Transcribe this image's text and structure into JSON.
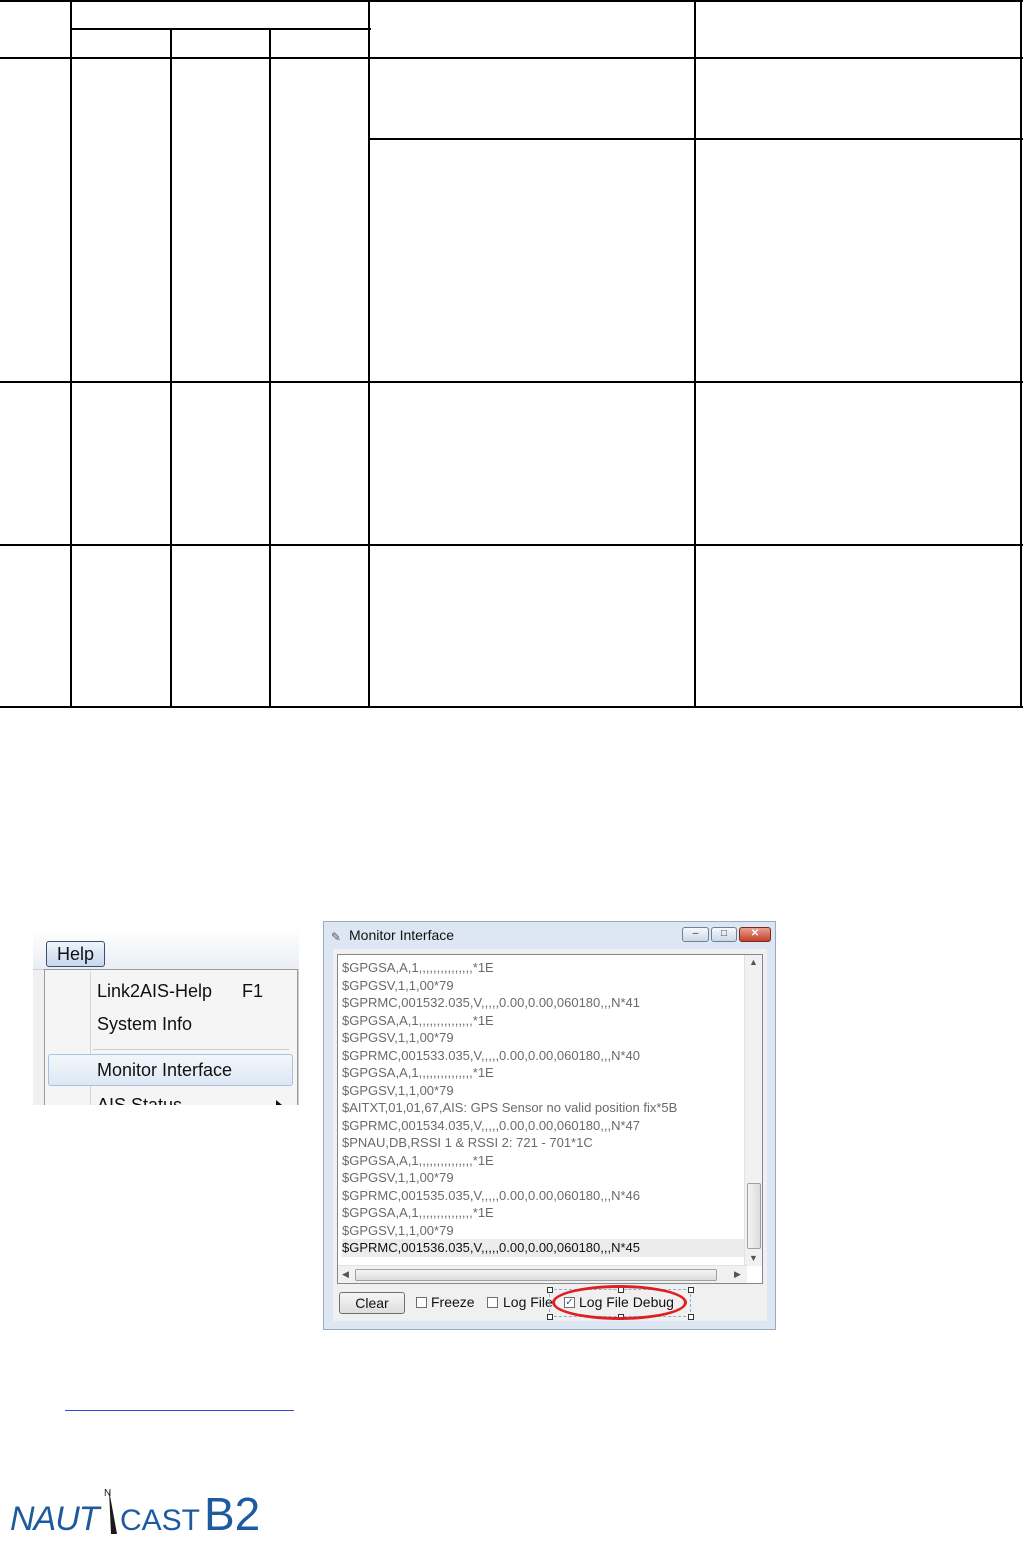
{
  "help_menu": {
    "menu_title": "Help",
    "items": [
      {
        "label": "Link2AIS-Help",
        "shortcut": "F1"
      },
      {
        "label": "System Info",
        "shortcut": ""
      },
      {
        "label": "Monitor Interface",
        "shortcut": ""
      },
      {
        "label": "AIS Status",
        "shortcut": ""
      }
    ],
    "selected_item": "Monitor Interface"
  },
  "monitor_window": {
    "title": "Monitor Interface",
    "log_lines": [
      "$GPGSA,A,1,,,,,,,,,,,,,,,*1E",
      "$GPGSV,1,1,00*79",
      "$GPRMC,001532.035,V,,,,,0.00,0.00,060180,,,N*41",
      "$GPGSA,A,1,,,,,,,,,,,,,,,*1E",
      "$GPGSV,1,1,00*79",
      "$GPRMC,001533.035,V,,,,,0.00,0.00,060180,,,N*40",
      "$GPGSA,A,1,,,,,,,,,,,,,,,*1E",
      "$GPGSV,1,1,00*79",
      "$AITXT,01,01,67,AIS: GPS Sensor no valid position fix*5B",
      "$GPRMC,001534.035,V,,,,,0.00,0.00,060180,,,N*47",
      "$PNAU,DB,RSSI 1 & RSSI 2: 721 - 701*1C",
      "$GPGSA,A,1,,,,,,,,,,,,,,,*1E",
      "$GPGSV,1,1,00*79",
      "$GPRMC,001535.035,V,,,,,0.00,0.00,060180,,,N*46",
      "$GPGSA,A,1,,,,,,,,,,,,,,,*1E",
      "$GPGSV,1,1,00*79",
      "$GPRMC,001536.035,V,,,,,0.00,0.00,060180,,,N*45"
    ],
    "clear_label": "Clear",
    "freeze_label": "Freeze",
    "freeze_checked": false,
    "log_file_label": "Log File",
    "log_file_checked": false,
    "log_file_debug_label": "Log File Debug",
    "log_file_debug_checked": true
  },
  "logo": {
    "brand_left": "NAUT",
    "brand_right": "CAST",
    "model": "B2",
    "compass_mark": "N",
    "colors": {
      "brand": "#1e5b9e",
      "needle": "#1a1a1a"
    }
  }
}
